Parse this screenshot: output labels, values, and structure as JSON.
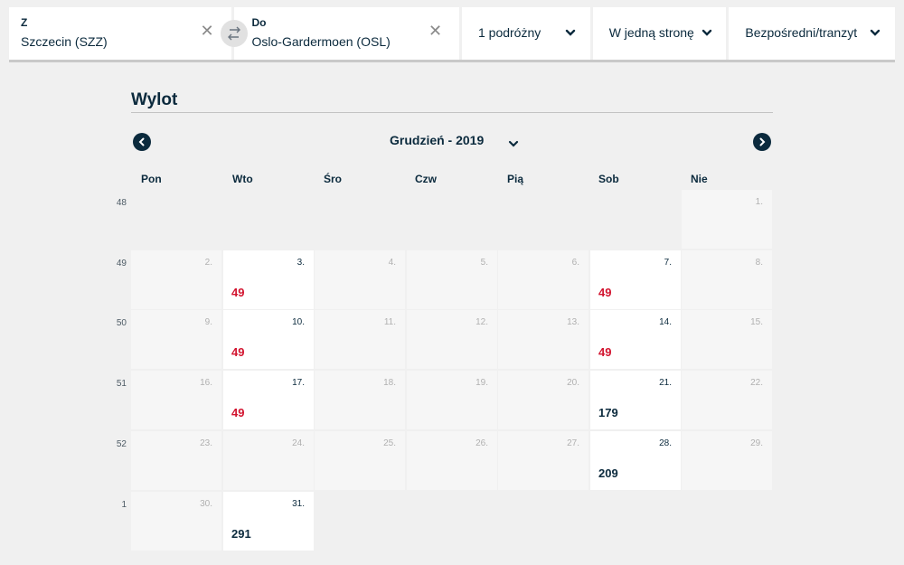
{
  "search": {
    "from": {
      "label": "Z",
      "value": "Szczecin (SZZ)"
    },
    "to": {
      "label": "Do",
      "value": "Oslo-Gardermoen (OSL)"
    },
    "travellers": "1 podróżny",
    "trip_type": "W jedną stronę",
    "stops": "Bezpośredni/tranzyt"
  },
  "calendar": {
    "title": "Wylot",
    "month": "Grudzień - 2019",
    "weekdays": [
      "Pon",
      "Wto",
      "Śro",
      "Czw",
      "Pią",
      "Sob",
      "Nie"
    ],
    "weeks": [
      {
        "week": "48",
        "days": [
          null,
          null,
          null,
          null,
          null,
          null,
          {
            "day": "1.",
            "price": null,
            "available": false
          }
        ]
      },
      {
        "week": "49",
        "days": [
          {
            "day": "2.",
            "price": null,
            "available": false
          },
          {
            "day": "3.",
            "price": "49",
            "available": true,
            "low": true
          },
          {
            "day": "4.",
            "price": null,
            "available": false
          },
          {
            "day": "5.",
            "price": null,
            "available": false
          },
          {
            "day": "6.",
            "price": null,
            "available": false
          },
          {
            "day": "7.",
            "price": "49",
            "available": true,
            "low": true
          },
          {
            "day": "8.",
            "price": null,
            "available": false
          }
        ]
      },
      {
        "week": "50",
        "days": [
          {
            "day": "9.",
            "price": null,
            "available": false
          },
          {
            "day": "10.",
            "price": "49",
            "available": true,
            "low": true
          },
          {
            "day": "11.",
            "price": null,
            "available": false
          },
          {
            "day": "12.",
            "price": null,
            "available": false
          },
          {
            "day": "13.",
            "price": null,
            "available": false
          },
          {
            "day": "14.",
            "price": "49",
            "available": true,
            "low": true
          },
          {
            "day": "15.",
            "price": null,
            "available": false
          }
        ]
      },
      {
        "week": "51",
        "days": [
          {
            "day": "16.",
            "price": null,
            "available": false
          },
          {
            "day": "17.",
            "price": "49",
            "available": true,
            "low": true
          },
          {
            "day": "18.",
            "price": null,
            "available": false
          },
          {
            "day": "19.",
            "price": null,
            "available": false
          },
          {
            "day": "20.",
            "price": null,
            "available": false
          },
          {
            "day": "21.",
            "price": "179",
            "available": true,
            "low": false
          },
          {
            "day": "22.",
            "price": null,
            "available": false
          }
        ]
      },
      {
        "week": "52",
        "days": [
          {
            "day": "23.",
            "price": null,
            "available": false
          },
          {
            "day": "24.",
            "price": null,
            "available": false
          },
          {
            "day": "25.",
            "price": null,
            "available": false
          },
          {
            "day": "26.",
            "price": null,
            "available": false
          },
          {
            "day": "27.",
            "price": null,
            "available": false
          },
          {
            "day": "28.",
            "price": "209",
            "available": true,
            "low": false
          },
          {
            "day": "29.",
            "price": null,
            "available": false
          }
        ]
      },
      {
        "week": "1",
        "days": [
          {
            "day": "30.",
            "price": null,
            "available": false
          },
          {
            "day": "31.",
            "price": "291",
            "available": true,
            "low": false
          },
          null,
          null,
          null,
          null,
          null
        ]
      }
    ]
  },
  "colors": {
    "primary": "#0b2a3d",
    "low_price": "#d2142f",
    "background": "#f0f0f0"
  }
}
